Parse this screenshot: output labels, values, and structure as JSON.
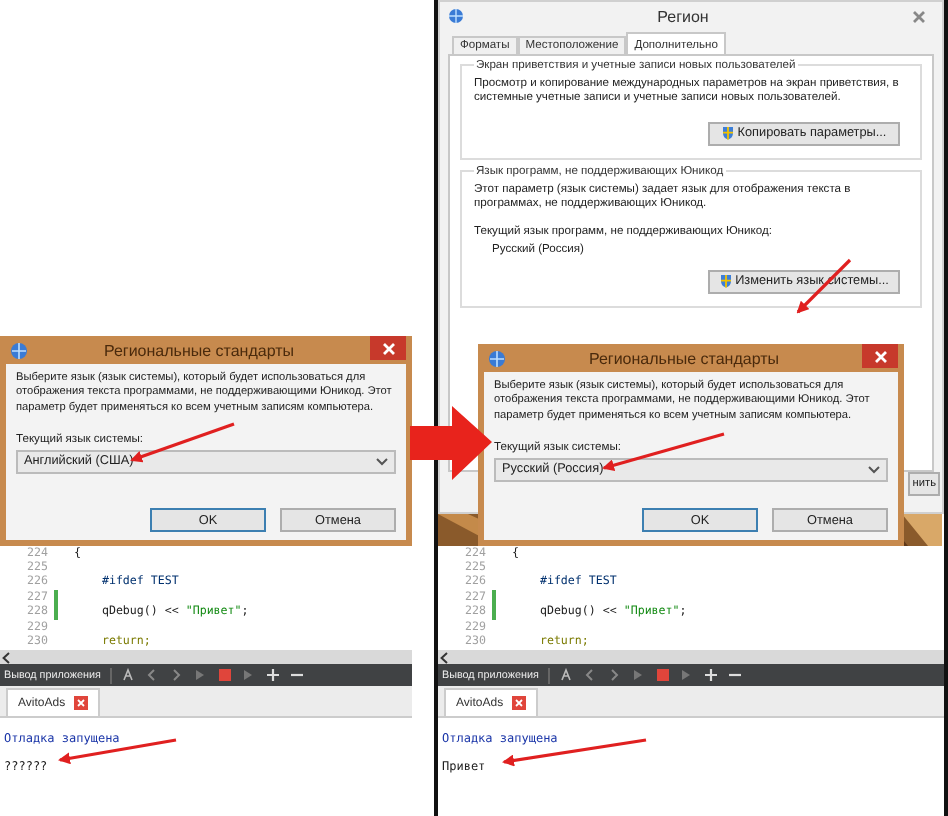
{
  "left_screen": {
    "dialog": {
      "title": "Региональные стандарты",
      "description": "Выберите язык (язык системы), который будет использоваться для отображения текста программами, не поддерживающими Юникод. Этот параметр будет применяться ко всем учетным записям компьютера.",
      "field_label": "Текущий язык системы:",
      "field_value": "Английский (США)",
      "buttons": [
        {
          "label": "OK",
          "default": true
        },
        {
          "label": "Отмена",
          "default": false
        }
      ]
    },
    "editor": {
      "lines": [
        {
          "number": "224",
          "code": [
            {
              "text": "{",
              "kind": "plain"
            }
          ],
          "modified": false
        },
        {
          "number": "225",
          "modified": false
        },
        {
          "number": "226",
          "code": [
            {
              "text": "    #ifdef TEST",
              "kind": "macro"
            }
          ],
          "modified": false
        },
        {
          "number": "227",
          "modified": true
        },
        {
          "number": "228",
          "code": [
            {
              "text": "    qDebug() << ",
              "kind": "plain"
            },
            {
              "text": "\"Привет\"",
              "kind": "string"
            },
            {
              "text": ";",
              "kind": "plain"
            }
          ],
          "modified": true
        },
        {
          "number": "229",
          "modified": false
        },
        {
          "number": "230",
          "code": [
            {
              "text": "    return;",
              "kind": "keyword"
            }
          ],
          "modified": false
        }
      ]
    },
    "output": {
      "title": "Вывод приложения",
      "tabs": [
        {
          "label": "AvitoAds",
          "selected": true
        }
      ],
      "lines": [
        {
          "text": "Отладка запущена",
          "kind": "status"
        },
        {
          "text": "??????",
          "kind": "text"
        }
      ]
    }
  },
  "right_screen": {
    "region_window": {
      "title": "Регион",
      "tabs": [
        {
          "label": "Форматы",
          "selected": false
        },
        {
          "label": "Местоположение",
          "selected": false
        },
        {
          "label": "Дополнительно",
          "selected": true
        }
      ],
      "groups": [
        {
          "title": "Экран приветствия и учетные записи новых пользователей",
          "description": "Просмотр и копирование международных параметров на экран приветствия, в системные учетные записи и учетные записи новых пользователей.",
          "button": "Копировать параметры..."
        },
        {
          "title": "Язык программ, не поддерживающих Юникод",
          "description": "Этот параметр (язык системы) задает язык для отображения текста в программах, не поддерживающих Юникод.",
          "current_label": "Текущий язык программ, не поддерживающих Юникод:",
          "current_value": "Русский (Россия)",
          "button": "Изменить язык системы..."
        }
      ],
      "partial_button": "нить"
    },
    "dialog": {
      "title": "Региональные стандарты",
      "description": "Выберите язык (язык системы), который будет использоваться для отображения текста программами, не поддерживающими Юникод. Этот параметр будет применяться ко всем учетным записям компьютера.",
      "field_label": "Текущий язык системы:",
      "field_value": "Русский (Россия)",
      "buttons": [
        {
          "label": "OK",
          "default": true
        },
        {
          "label": "Отмена",
          "default": false
        }
      ]
    },
    "editor": {
      "lines": [
        {
          "number": "224",
          "code": [
            {
              "text": "{",
              "kind": "plain"
            }
          ],
          "modified": false
        },
        {
          "number": "225",
          "modified": false
        },
        {
          "number": "226",
          "code": [
            {
              "text": "    #ifdef TEST",
              "kind": "macro"
            }
          ],
          "modified": false
        },
        {
          "number": "227",
          "modified": true
        },
        {
          "number": "228",
          "code": [
            {
              "text": "    qDebug() << ",
              "kind": "plain"
            },
            {
              "text": "\"Привет\"",
              "kind": "string"
            },
            {
              "text": ";",
              "kind": "plain"
            }
          ],
          "modified": true
        },
        {
          "number": "229",
          "modified": false
        },
        {
          "number": "230",
          "code": [
            {
              "text": "    return;",
              "kind": "keyword"
            }
          ],
          "modified": false
        }
      ]
    },
    "output": {
      "title": "Вывод приложения",
      "tabs": [
        {
          "label": "AvitoAds",
          "selected": true
        }
      ],
      "lines": [
        {
          "text": "Отладка запущена",
          "kind": "status"
        },
        {
          "text": "Привет",
          "kind": "text"
        }
      ]
    }
  }
}
